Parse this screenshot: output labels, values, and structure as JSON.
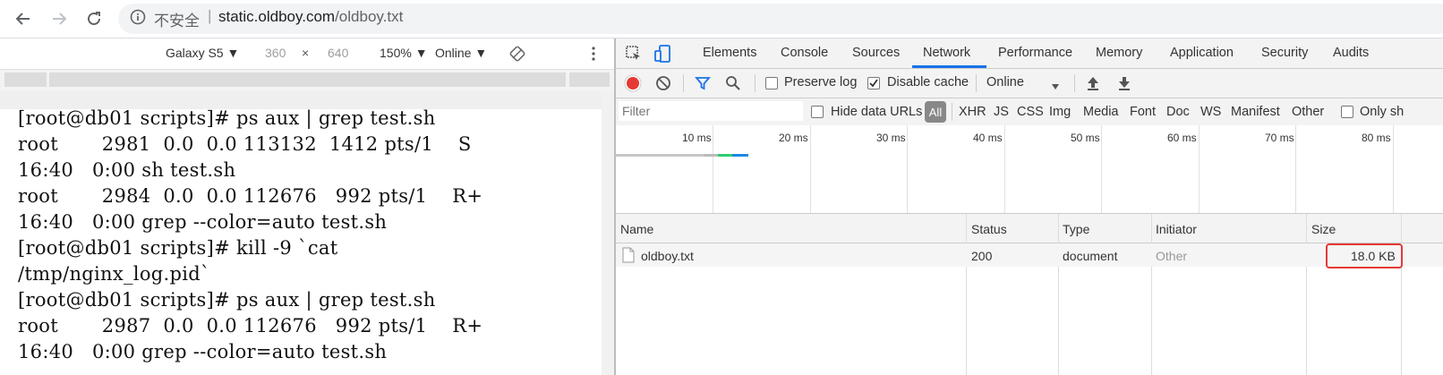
{
  "browser": {
    "insecure_label": "不安全",
    "separator": "|",
    "url_host": "static.oldboy.com",
    "url_path": "/oldboy.txt"
  },
  "device_toolbar": {
    "device": "Galaxy S5 ▼",
    "width": "360",
    "times": "×",
    "height": "640",
    "zoom": "150% ▼",
    "network": "Online ▼"
  },
  "terminal_lines": [
    "[root@db01 scripts]# ps aux | grep test.sh",
    "root       2981  0.0  0.0 113132  1412 pts/1    S",
    "16:40   0:00 sh test.sh",
    "root       2984  0.0  0.0 112676   992 pts/1    R+",
    "16:40   0:00 grep --color=auto test.sh",
    "[root@db01 scripts]# kill -9 `cat",
    "/tmp/nginx_log.pid`",
    "[root@db01 scripts]# ps aux | grep test.sh",
    "root       2987  0.0  0.0 112676   992 pts/1    R+",
    "16:40   0:00 grep --color=auto test.sh"
  ],
  "devtools": {
    "tabs": [
      "Elements",
      "Console",
      "Sources",
      "Network",
      "Performance",
      "Memory",
      "Application",
      "Security",
      "Audits"
    ],
    "active_tab": "Network",
    "toolbar": {
      "preserve_log": "Preserve log",
      "disable_cache": "Disable cache",
      "throttle": "Online"
    },
    "filter": {
      "placeholder": "Filter",
      "hide_data_urls": "Hide data URLs",
      "types": [
        "All",
        "XHR",
        "JS",
        "CSS",
        "Img",
        "Media",
        "Font",
        "Doc",
        "WS",
        "Manifest",
        "Other"
      ],
      "only_label": "Only sh"
    },
    "timeline_ticks": [
      "10 ms",
      "20 ms",
      "30 ms",
      "40 ms",
      "50 ms",
      "60 ms",
      "70 ms",
      "80 ms"
    ],
    "table": {
      "columns": [
        "Name",
        "Status",
        "Type",
        "Initiator",
        "Size"
      ],
      "rows": [
        {
          "name": "oldboy.txt",
          "status": "200",
          "type": "document",
          "initiator": "Other",
          "size": "18.0 KB"
        }
      ]
    }
  },
  "colors": {
    "active_tab": "#1a73e8",
    "record": "#e53935",
    "highlight_box": "#e53935"
  }
}
